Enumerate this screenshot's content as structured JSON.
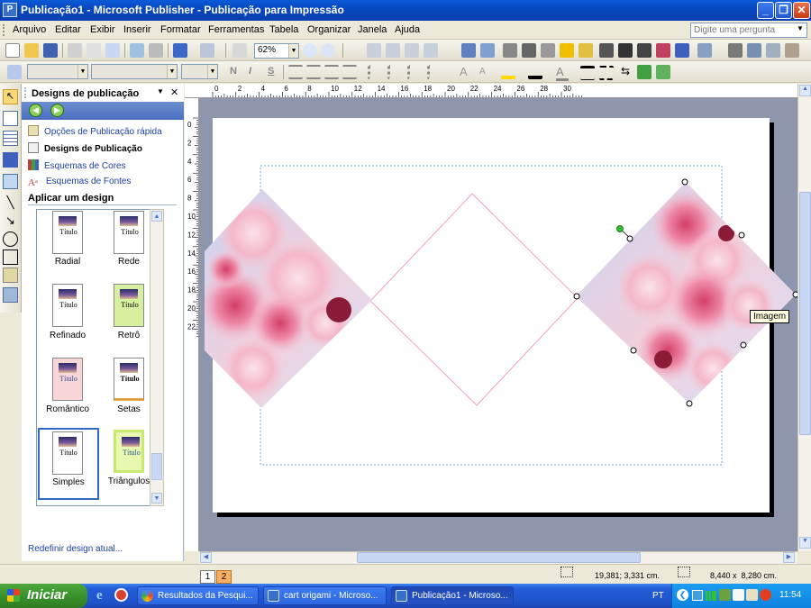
{
  "window": {
    "title": "Publicação1 - Microsoft Publisher - Publicação para Impressão",
    "app_icon": "P",
    "buttons": {
      "minimize": "_",
      "maximize": "❐",
      "close": "✕"
    }
  },
  "menu": {
    "items": [
      "Arquivo",
      "Editar",
      "Exibir",
      "Inserir",
      "Formatar",
      "Ferramentas",
      "Tabela",
      "Organizar",
      "Janela",
      "Ajuda"
    ],
    "ask_placeholder": "Digite uma pergunta"
  },
  "standard_toolbar": {
    "zoom": "62%"
  },
  "task_pane": {
    "title": "Designs de publicação",
    "links": [
      {
        "label": "Opções de Publicação rápida",
        "icon": "quick-publication-icon"
      },
      {
        "label": "Designs de Publicação",
        "icon": "publication-designs-icon"
      },
      {
        "label": "Esquemas de Cores",
        "icon": "color-schemes-icon"
      },
      {
        "label": "Esquemas de Fontes",
        "icon": "font-schemes-icon"
      }
    ],
    "section_title": "Aplicar um design",
    "designs": [
      {
        "label": "Radial",
        "thumb_text": "Título",
        "bg": "#ffffff"
      },
      {
        "label": "Rede",
        "thumb_text": "Título",
        "bg": "#ffffff"
      },
      {
        "label": "Refinado",
        "thumb_text": "Título",
        "bg": "#ffffff"
      },
      {
        "label": "Retrô",
        "thumb_text": "Título",
        "bg": "#d6f0a0"
      },
      {
        "label": "Romântico",
        "thumb_text": "Título",
        "bg": "#f8d6d8"
      },
      {
        "label": "Setas",
        "thumb_text": "Título",
        "bg": "#ffffff"
      },
      {
        "label": "Simples",
        "thumb_text": "Título",
        "bg": "#ffffff"
      },
      {
        "label": "Triângulos",
        "thumb_text": "Título",
        "bg": "#e8f8b0"
      }
    ],
    "selected_design": "Simples",
    "reset_link": "Redefinir design atual..."
  },
  "rulers": {
    "h_ticks": [
      "0",
      "2",
      "4",
      "6",
      "8",
      "10",
      "12",
      "14",
      "16",
      "18",
      "20",
      "22",
      "24",
      "26",
      "28",
      "30"
    ],
    "v_ticks": [
      "0",
      "2",
      "4",
      "6",
      "8",
      "10",
      "12",
      "14",
      "16",
      "18",
      "20",
      "22"
    ]
  },
  "canvas": {
    "tooltip": "Imagem"
  },
  "status_bar": {
    "pages": [
      "1",
      "2"
    ],
    "position": "19,381; 3,331 cm.",
    "size": "8,440 x  8,280 cm."
  },
  "taskbar": {
    "start_label": "Iniciar",
    "buttons": [
      {
        "label": "Resultados da Pesqui...",
        "icon": "google-icon"
      },
      {
        "label": "cart origami - Microso...",
        "icon": "publisher-icon"
      },
      {
        "label": "Publicação1 - Microso...",
        "icon": "publisher-icon"
      }
    ],
    "language": "PT",
    "clock": "11:54"
  }
}
